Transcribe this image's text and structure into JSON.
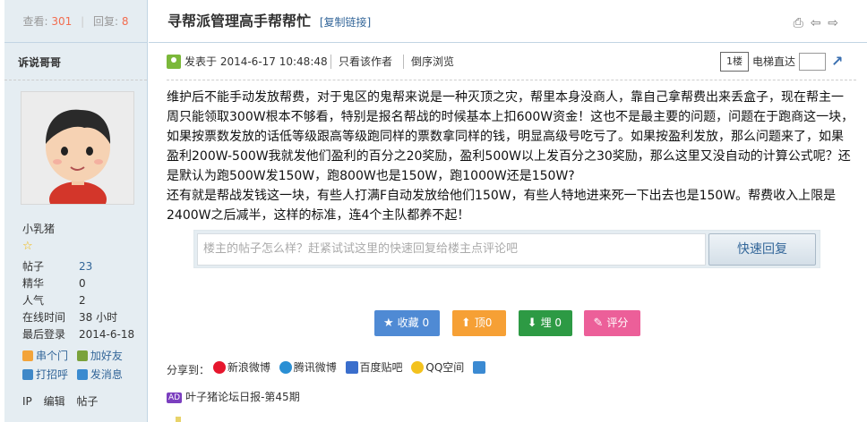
{
  "stats": {
    "views_label": "查看:",
    "views": "301",
    "replies_label": "回复:",
    "replies": "8"
  },
  "author": {
    "name": "诉说哥哥",
    "usergroup": "小乳猪",
    "profile": [
      {
        "key": "帖子",
        "value": "23",
        "link": true
      },
      {
        "key": "精华",
        "value": "0",
        "link": false
      },
      {
        "key": "人气",
        "value": "2",
        "link": false
      },
      {
        "key": "在线时间",
        "value": "38 小时",
        "link": false
      },
      {
        "key": "最后登录",
        "value": "2014-6-18",
        "link": false
      }
    ],
    "actions": {
      "visit": "串个门",
      "add_friend": "加好友",
      "poke": "打招呼",
      "message": "发消息"
    },
    "bottom_links": {
      "ip": "IP",
      "edit": "编辑",
      "posts": "帖子"
    }
  },
  "thread": {
    "title": "寻帮派管理高手帮帮忙",
    "copy_link": "[复制链接]"
  },
  "post": {
    "posted_at": "发表于 2014-6-17 10:48:48",
    "only_author": "只看该作者",
    "reverse": "倒序浏览",
    "floor": "1楼",
    "elevator_label": "电梯直达",
    "paragraphs": [
      "维护后不能手动发放帮费，对于鬼区的鬼帮来说是一种灭顶之灾，帮里本身没商人，靠自己拿帮费出来丢盒子，现在帮主一周只能领取300W根本不够看，特别是报名帮战的时候基本上扣600W资金！这也不是最主要的问题，问题在于跑商这一块，如果按票数发放的话低等级跟高等级跑同样的票数拿同样的钱，明显高级号吃亏了。如果按盈利发放，那么问题来了，如果盈利200W-500W我就发他们盈利的百分之20奖励，盈利500W以上发百分之30奖励，那么这里又没自动的计算公式呢？还是默认为跑500W发150W，跑800W也是150W，跑1000W还是150W?",
      "还有就是帮战发钱这一块，有些人打满F自动发放给他们150W，有些人特地进来死一下出去也是150W。帮费收入上限是2400W之后减半，这样的标准，连4个主队都养不起！"
    ]
  },
  "quick_reply": {
    "placeholder": "楼主的帖子怎么样？赶紧试试这里的快速回复给楼主点评论吧",
    "button": "快速回复"
  },
  "votes": {
    "favorite": "收藏",
    "favorite_count": "0",
    "up": "顶",
    "up_count": "0",
    "down": "埋",
    "down_count": "0",
    "rate": "评分"
  },
  "share": {
    "label": "分享到：",
    "sina": "新浪微博",
    "tencent": "腾讯微博",
    "baidu": "百度贴吧",
    "qzone": "QQ空间"
  },
  "ad": {
    "tag": "AD",
    "text": "叶子猪论坛日报-第45期"
  }
}
